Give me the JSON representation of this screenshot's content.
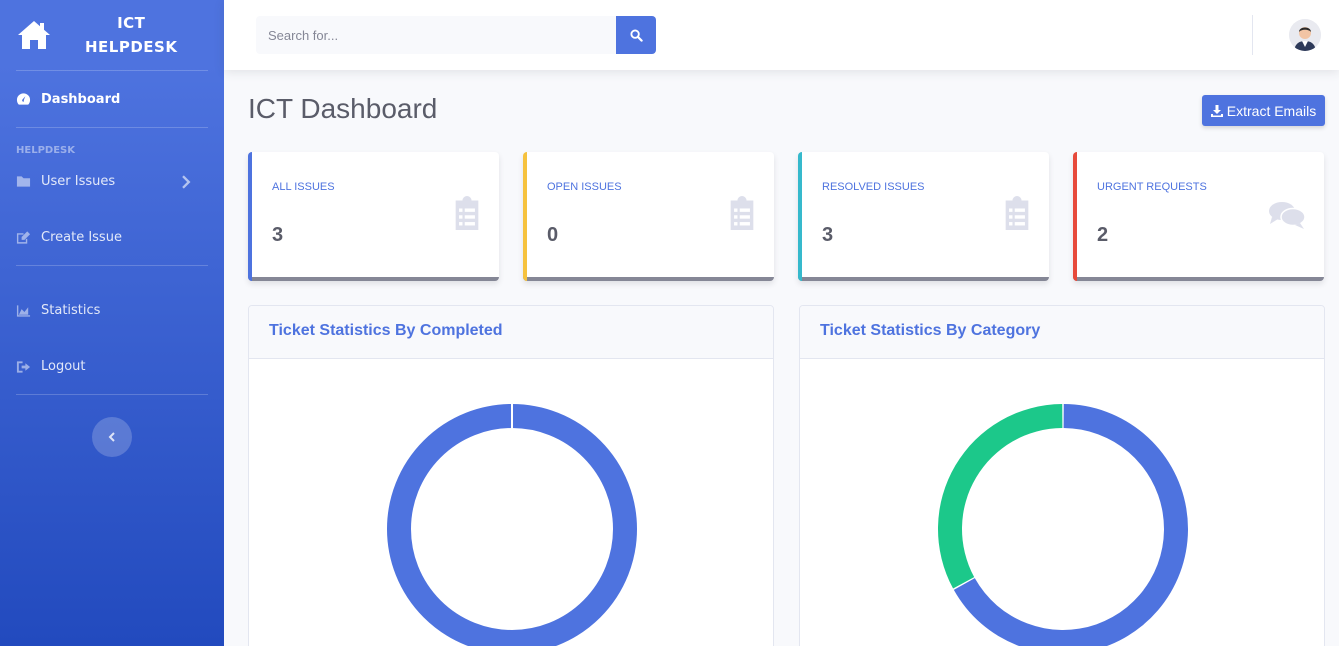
{
  "brand": {
    "line1": "ICT",
    "line2": "HELPDESK"
  },
  "sidebar": {
    "dashboard": "Dashboard",
    "heading": "HELPDESK",
    "user_issues": "User Issues",
    "create_issue": "Create Issue",
    "statistics": "Statistics",
    "logout": "Logout"
  },
  "search": {
    "placeholder": "Search for..."
  },
  "page": {
    "title": "ICT Dashboard",
    "extract_label": "Extract Emails"
  },
  "cards": [
    {
      "label": "ALL ISSUES",
      "value": "3",
      "icon": "clipboard-list-icon",
      "color": "#4e73df"
    },
    {
      "label": "OPEN ISSUES",
      "value": "0",
      "icon": "clipboard-list-icon",
      "color": "#f6c23e"
    },
    {
      "label": "RESOLVED ISSUES",
      "value": "3",
      "icon": "clipboard-list-icon",
      "color": "#36b9cc"
    },
    {
      "label": "URGENT REQUESTS",
      "value": "2",
      "icon": "comments-icon",
      "color": "#e74a3b"
    }
  ],
  "chart_data": [
    {
      "type": "pie",
      "title": "Ticket Statistics By Completed",
      "slices": [
        {
          "value": 1,
          "color": "#4e73df"
        }
      ]
    },
    {
      "type": "pie",
      "title": "Ticket Statistics By Category",
      "slices": [
        {
          "value": 0.67,
          "color": "#4e73df"
        },
        {
          "value": 0.33,
          "color": "#1cc88a"
        }
      ]
    }
  ]
}
